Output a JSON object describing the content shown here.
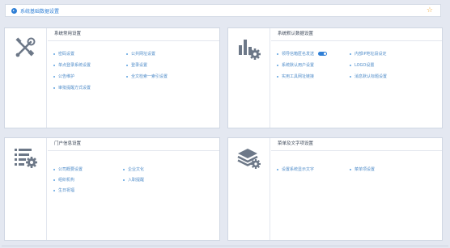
{
  "header": {
    "title": "系统基础数据设置"
  },
  "colors": {
    "accent": "#2f7fd6",
    "star": "#f0a93a",
    "link": "#4f8cc9",
    "icon": "#6d7888"
  },
  "icons": {
    "back": "back-circle-icon",
    "star": "star-icon",
    "common": "tools-icon",
    "default": "chart-gear-icon",
    "portal": "list-gear-icon",
    "menu": "layers-icon"
  },
  "cards": {
    "common": {
      "title": "系统常用设置",
      "items": [
        "密码设置",
        "公共网址设置",
        "单点登录系统设置",
        "登录设置",
        "公告维护",
        "全文检索一索引设置",
        "审批提醒方式设置"
      ]
    },
    "default": {
      "title": "系统默认数据设置",
      "items": [
        "领导信箱匿名发送",
        "内部IP地址段设定",
        "系统默认用户设置",
        "LOGO设置",
        "实用工具网址链接",
        "消息默认标题设置"
      ],
      "toggle_on": true
    },
    "portal": {
      "title": "门户信息设置",
      "items": [
        "公司概要设置",
        "企业文化",
        "组织机构",
        "入职提醒",
        "生日祝福"
      ]
    },
    "menu": {
      "title": "菜单及文字项设置",
      "items": [
        "设置系统显示文字",
        "菜单项设置"
      ]
    }
  }
}
